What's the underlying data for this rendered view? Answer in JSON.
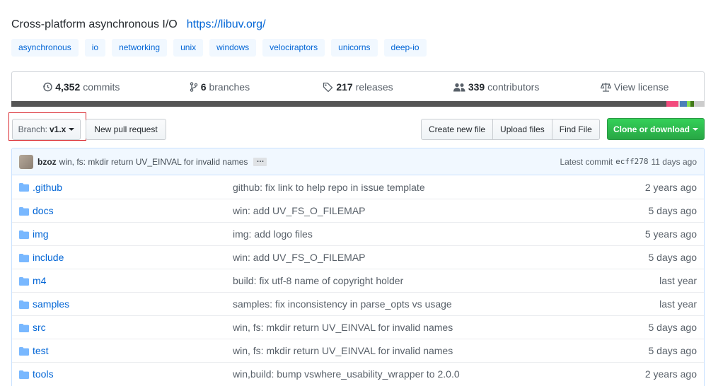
{
  "repo": {
    "description": "Cross-platform asynchronous I/O",
    "homepage": "https://libuv.org/",
    "topics": [
      "asynchronous",
      "io",
      "networking",
      "unix",
      "windows",
      "velociraptors",
      "unicorns",
      "deep-io"
    ]
  },
  "summary": {
    "commits": {
      "count": "4,352",
      "label": "commits",
      "icon": "history-icon"
    },
    "branches": {
      "count": "6",
      "label": "branches",
      "icon": "branch-icon"
    },
    "releases": {
      "count": "217",
      "label": "releases",
      "icon": "tag-icon"
    },
    "contributors": {
      "count": "339",
      "label": "contributors",
      "icon": "people-icon"
    },
    "license": {
      "label": "View license",
      "icon": "law-icon"
    }
  },
  "language_bar": {
    "colors": [
      "#555555",
      "#f34b7d",
      "#e0e0e0",
      "#4c7fb8",
      "#89e051",
      "#427819",
      "#cccccc"
    ],
    "fractions": [
      0.945,
      0.017,
      0.002,
      0.01,
      0.006,
      0.005,
      0.015
    ]
  },
  "toolbar": {
    "branch_prefix": "Branch:",
    "branch_name": "v1.x",
    "new_pull_request": "New pull request",
    "create_new_file": "Create new file",
    "upload_files": "Upload files",
    "find_file": "Find File",
    "clone_or_download": "Clone or download"
  },
  "latest_commit": {
    "author": "bzoz",
    "message": "win, fs: mkdir return UV_EINVAL for invalid names",
    "ellipsis": "…",
    "label": "Latest commit",
    "sha": "ecff278",
    "age": "11 days ago"
  },
  "files": [
    {
      "name": ".github",
      "message": "github: fix link to help repo in issue template",
      "age": "2 years ago"
    },
    {
      "name": "docs",
      "message": "win: add UV_FS_O_FILEMAP",
      "age": "5 days ago"
    },
    {
      "name": "img",
      "message": "img: add logo files",
      "age": "5 years ago"
    },
    {
      "name": "include",
      "message": "win: add UV_FS_O_FILEMAP",
      "age": "5 days ago"
    },
    {
      "name": "m4",
      "message": "build: fix utf-8 name of copyright holder",
      "age": "last year"
    },
    {
      "name": "samples",
      "message": "samples: fix inconsistency in parse_opts vs usage",
      "age": "last year"
    },
    {
      "name": "src",
      "message": "win, fs: mkdir return UV_EINVAL for invalid names",
      "age": "5 days ago"
    },
    {
      "name": "test",
      "message": "win, fs: mkdir return UV_EINVAL for invalid names",
      "age": "5 days ago"
    },
    {
      "name": "tools",
      "message": "win,build: bump vswhere_usability_wrapper to 2.0.0",
      "age": "2 years ago"
    }
  ]
}
